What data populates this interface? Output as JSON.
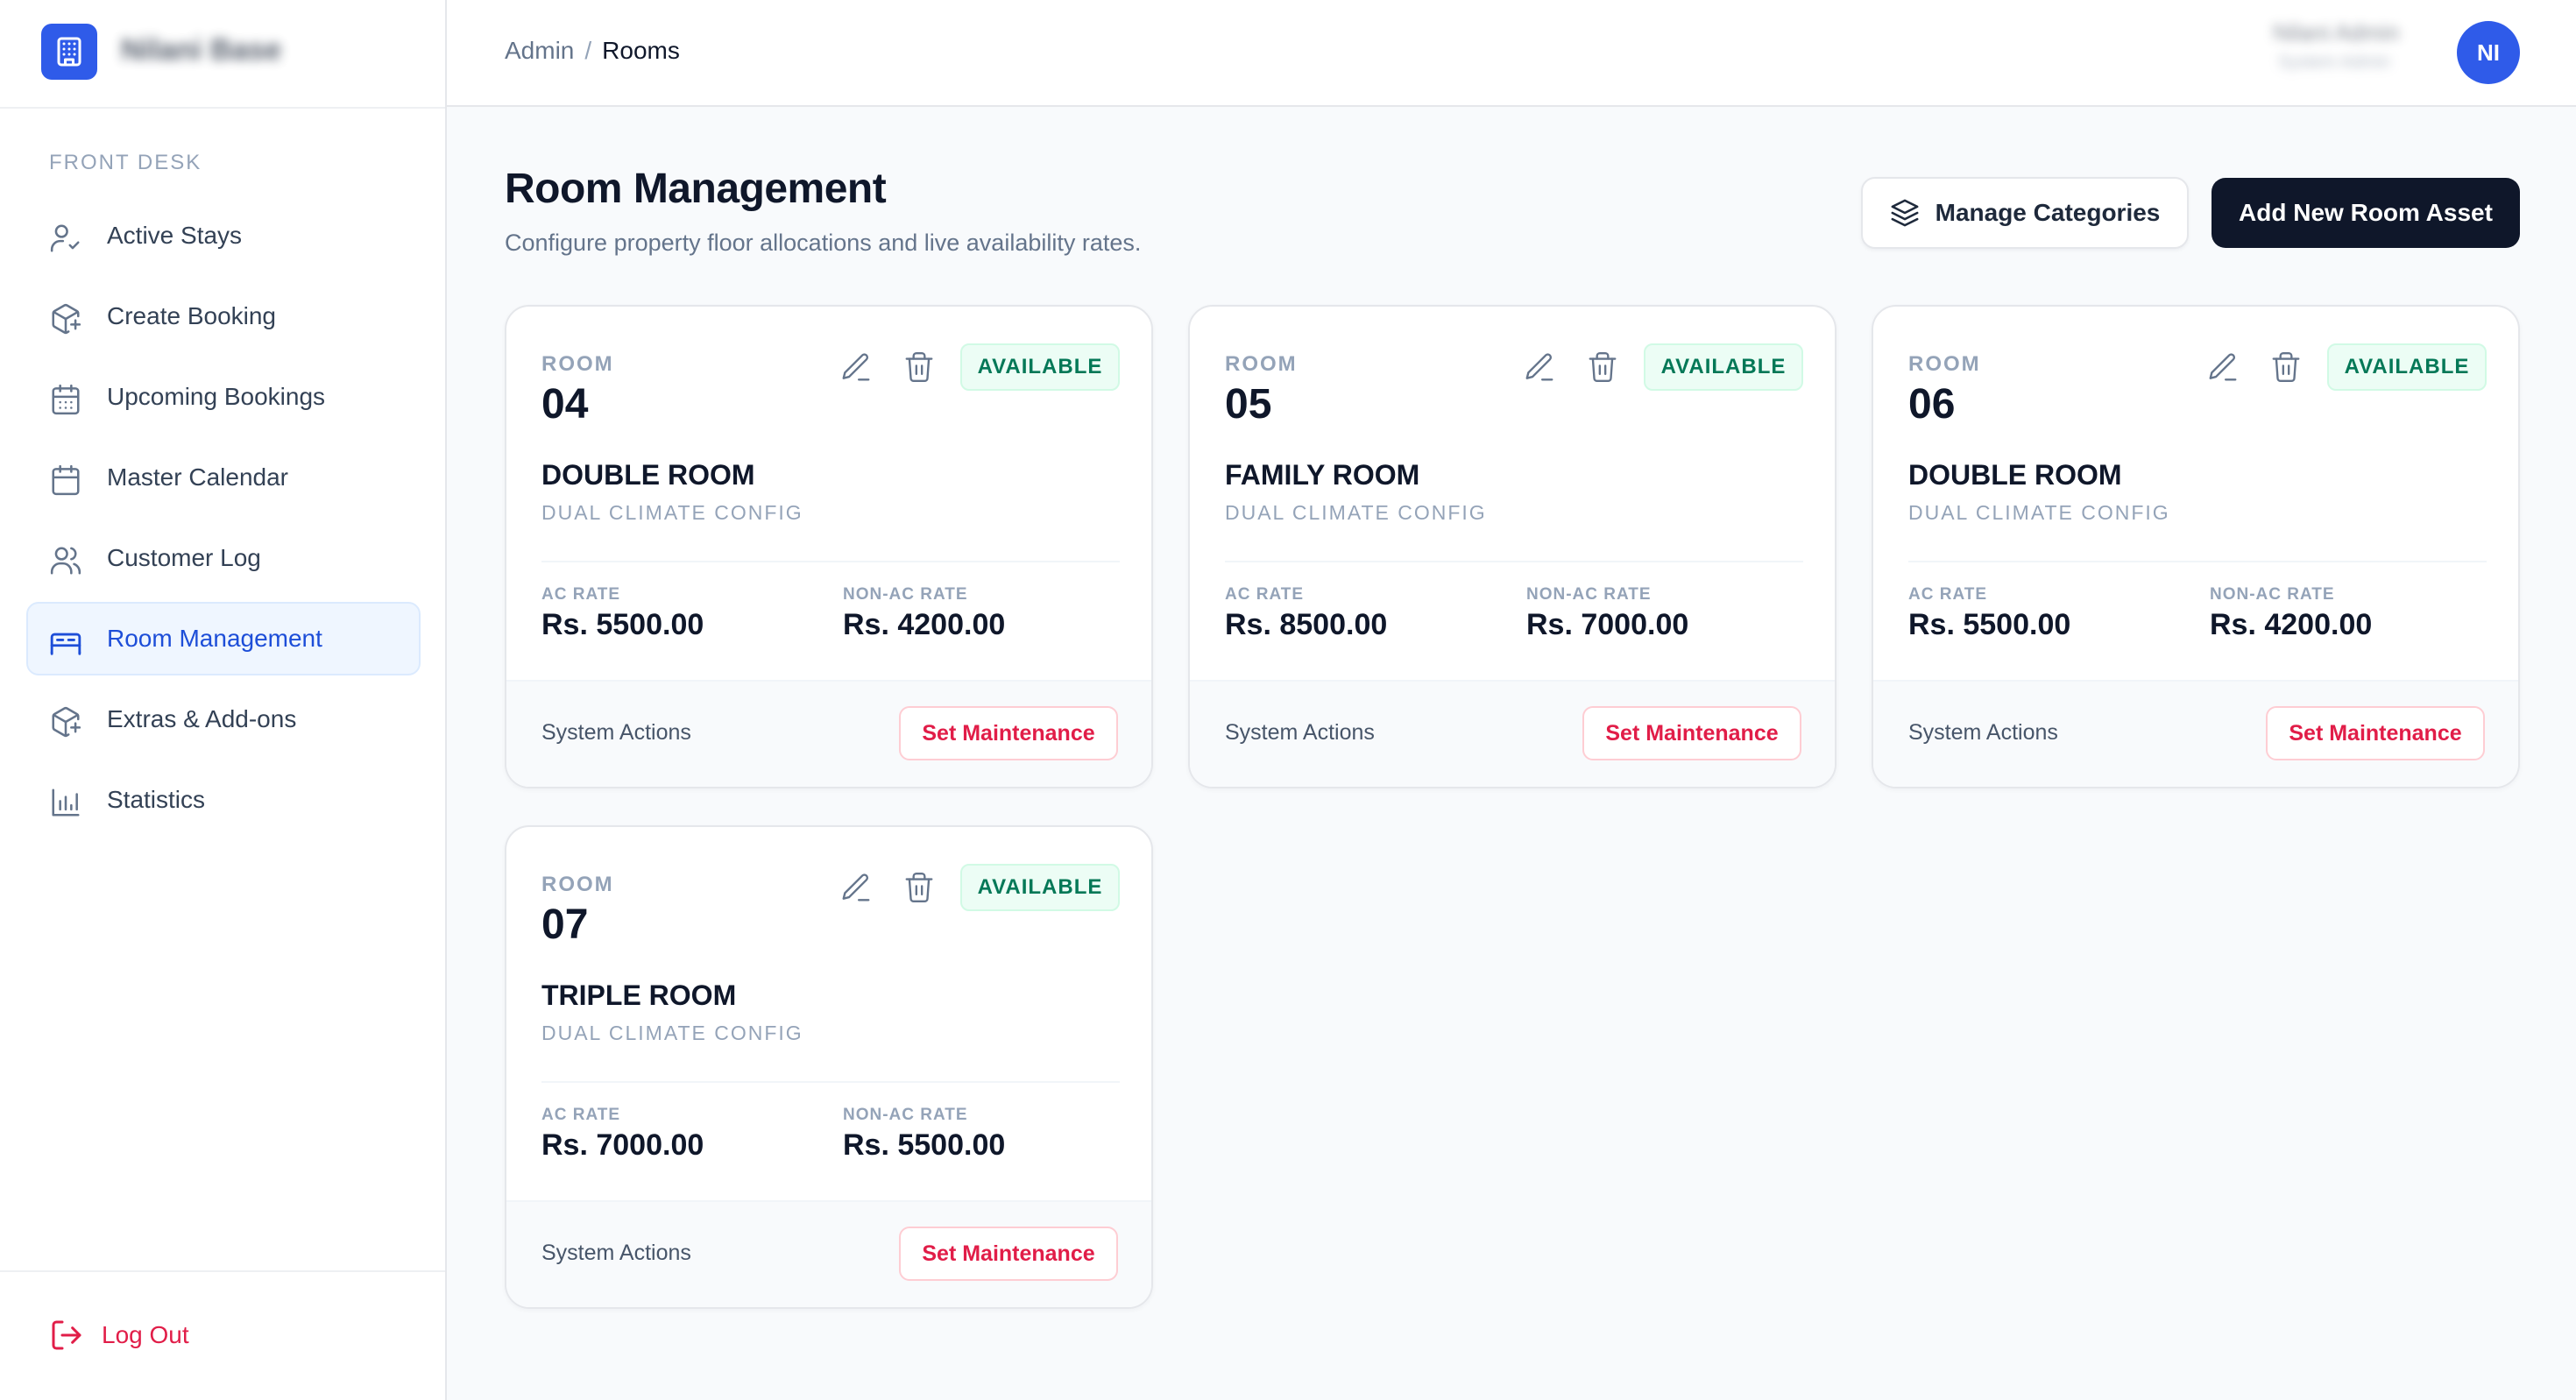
{
  "brand": {
    "name": "Nilani Base"
  },
  "sidebar": {
    "section_label": "FRONT DESK",
    "items": [
      {
        "label": "Active Stays",
        "icon": "user-check-icon"
      },
      {
        "label": "Create Booking",
        "icon": "package-plus-icon"
      },
      {
        "label": "Upcoming Bookings",
        "icon": "calendar-days-icon"
      },
      {
        "label": "Master Calendar",
        "icon": "calendar-icon"
      },
      {
        "label": "Customer Log",
        "icon": "users-icon"
      },
      {
        "label": "Room Management",
        "icon": "bed-icon",
        "active": true
      },
      {
        "label": "Extras & Add-ons",
        "icon": "package-plus-icon"
      },
      {
        "label": "Statistics",
        "icon": "bar-chart-icon"
      }
    ],
    "logout_label": "Log Out"
  },
  "header": {
    "breadcrumb": {
      "root": "Admin",
      "separator": "/",
      "current": "Rooms"
    },
    "user": {
      "name": "Nilani Admin",
      "role": "System Admin",
      "initials": "NI"
    }
  },
  "main": {
    "title": "Room Management",
    "subtitle": "Configure property floor allocations and live availability rates.",
    "manage_categories_label": "Manage Categories",
    "add_room_label": "Add New Room Asset"
  },
  "rooms": [
    {
      "room_label": "ROOM",
      "number": "04",
      "status": "AVAILABLE",
      "type": "DOUBLE ROOM",
      "config": "DUAL CLIMATE CONFIG",
      "ac_label": "AC RATE",
      "ac_rate": "Rs. 5500.00",
      "nonac_label": "NON-AC RATE",
      "nonac_rate": "Rs. 4200.00",
      "footer_label": "System Actions",
      "action_label": "Set Maintenance"
    },
    {
      "room_label": "ROOM",
      "number": "05",
      "status": "AVAILABLE",
      "type": "FAMILY ROOM",
      "config": "DUAL CLIMATE CONFIG",
      "ac_label": "AC RATE",
      "ac_rate": "Rs. 8500.00",
      "nonac_label": "NON-AC RATE",
      "nonac_rate": "Rs. 7000.00",
      "footer_label": "System Actions",
      "action_label": "Set Maintenance"
    },
    {
      "room_label": "ROOM",
      "number": "06",
      "status": "AVAILABLE",
      "type": "DOUBLE ROOM",
      "config": "DUAL CLIMATE CONFIG",
      "ac_label": "AC RATE",
      "ac_rate": "Rs. 5500.00",
      "nonac_label": "NON-AC RATE",
      "nonac_rate": "Rs. 4200.00",
      "footer_label": "System Actions",
      "action_label": "Set Maintenance"
    },
    {
      "room_label": "ROOM",
      "number": "07",
      "status": "AVAILABLE",
      "type": "TRIPLE ROOM",
      "config": "DUAL CLIMATE CONFIG",
      "ac_label": "AC RATE",
      "ac_rate": "Rs. 7000.00",
      "nonac_label": "NON-AC RATE",
      "nonac_rate": "Rs. 5500.00",
      "footer_label": "System Actions",
      "action_label": "Set Maintenance"
    }
  ],
  "colors": {
    "accent": "#2f5be9",
    "primary_button": "#0f172a",
    "available_text": "#047857",
    "available_bg": "#ecfdf5",
    "danger": "#e11d48"
  }
}
